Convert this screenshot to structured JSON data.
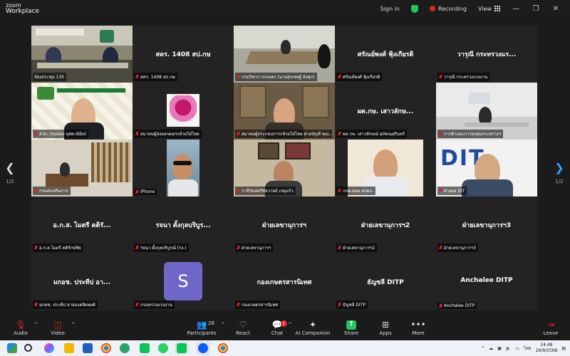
{
  "window": {
    "brand_line1": "zoom",
    "brand_line2": "Workplace",
    "sign_in": "Sign in",
    "recording": "Recording",
    "view": "View"
  },
  "pager": {
    "left": "1/2",
    "right": "1/2"
  },
  "tiles": [
    {
      "name": "ห้องประชุม 135",
      "center": ""
    },
    {
      "name": "สคร. 1408 สป.กษ",
      "center": "สคร. 1408 สป.กษ"
    },
    {
      "name": "กรมวิชาการเกษตร (นายสุรเชษฐ์ อังศุภ)",
      "center": ""
    },
    {
      "name": "ศรัณย์พงศ์ ฟุ้งเกียรติ",
      "center": "ศรัณย์พงศ์ ฟุ้งเกียรติ"
    },
    {
      "name": "วารุณี กระทรวงแรงงาน",
      "center": "วารุณี กระทรวงแร..."
    },
    {
      "name": "สวก. (ขุนทอง บุศสะนิมิต)",
      "center": ""
    },
    {
      "name": "สมาคมผู้ส่งออกดอกกล้วยไม้ไทย",
      "center": ""
    },
    {
      "name": "สมาคมผู้ประกอบการกล้วยไม้ไทย ฝ่ายบัญชี คุณ...",
      "center": ""
    },
    {
      "name": "ผต.กษ. เสาวลักษณ์ สุภัคณสุรินทร์",
      "center": "ผต.กษ. เสาวลักษ..."
    },
    {
      "name": "การค้าและการลงทุนกระทรวงฯ",
      "center": ""
    },
    {
      "name": "กรมส่งเสริมการ",
      "center": ""
    },
    {
      "name": "iPhone",
      "center": ""
    },
    {
      "name": "ราชีรัตน์ศรีชัยวาลย์ เกตุแก้ว",
      "center": ""
    },
    {
      "name": "กกค.สมผ.สปผก.",
      "center": ""
    },
    {
      "name": "ฝ่ายผอ DIT",
      "center": ""
    },
    {
      "name": "อ.ก.ส.ไมตรี คติรักษ์ชัย",
      "center": "อ.ก.ส. ไมตรี คติรั..."
    },
    {
      "name": "รจนา ตั้งกุลบริบูรณ์ (รง.)",
      "center": "รจนา ตั้งกุลบริบูร..."
    },
    {
      "name": "ฝ่ายเลขานุการฯ",
      "center": "ฝ่ายเลขานุการฯ"
    },
    {
      "name": "ฝ่ายเลขานุการฯ2",
      "center": "ฝ่ายเลขานุการฯ2"
    },
    {
      "name": "ฝ่ายเลขานุการฯ3",
      "center": "ฝ่ายเลขานุการฯ3"
    },
    {
      "name": "มกอช. ประทีป อาจมงคลิดพงศ์",
      "center": "มกอช. ประทีป อา..."
    },
    {
      "name": "กรมทรวงแรงงาน",
      "center": "",
      "avatar": "S"
    },
    {
      "name": "กองเกษตรสารนิเทศ",
      "center": "กองเกษตรสารนิเทศ"
    },
    {
      "name": "ธัญชลี DITP",
      "center": "ธัญชลี DITP"
    },
    {
      "name": "Anchalee DITP",
      "center": "Anchalee DITP"
    }
  ],
  "toolbar": {
    "audio": "Audio",
    "video": "Video",
    "participants": "Participants",
    "participants_count": "28",
    "react": "React",
    "chat": "Chat",
    "chat_badge": "1",
    "ai_companion": "AI Companion",
    "share": "Share",
    "apps": "Apps",
    "more": "More",
    "leave": "Leave"
  },
  "taskbar": {
    "lang": "ไทย",
    "time": "14:48",
    "date": "16/9/2568"
  },
  "colors": {
    "active_border": "#3ad16f",
    "recording": "#e02424",
    "avatar_s": "#6f68c9",
    "pager_accent": "#33a1ff"
  }
}
